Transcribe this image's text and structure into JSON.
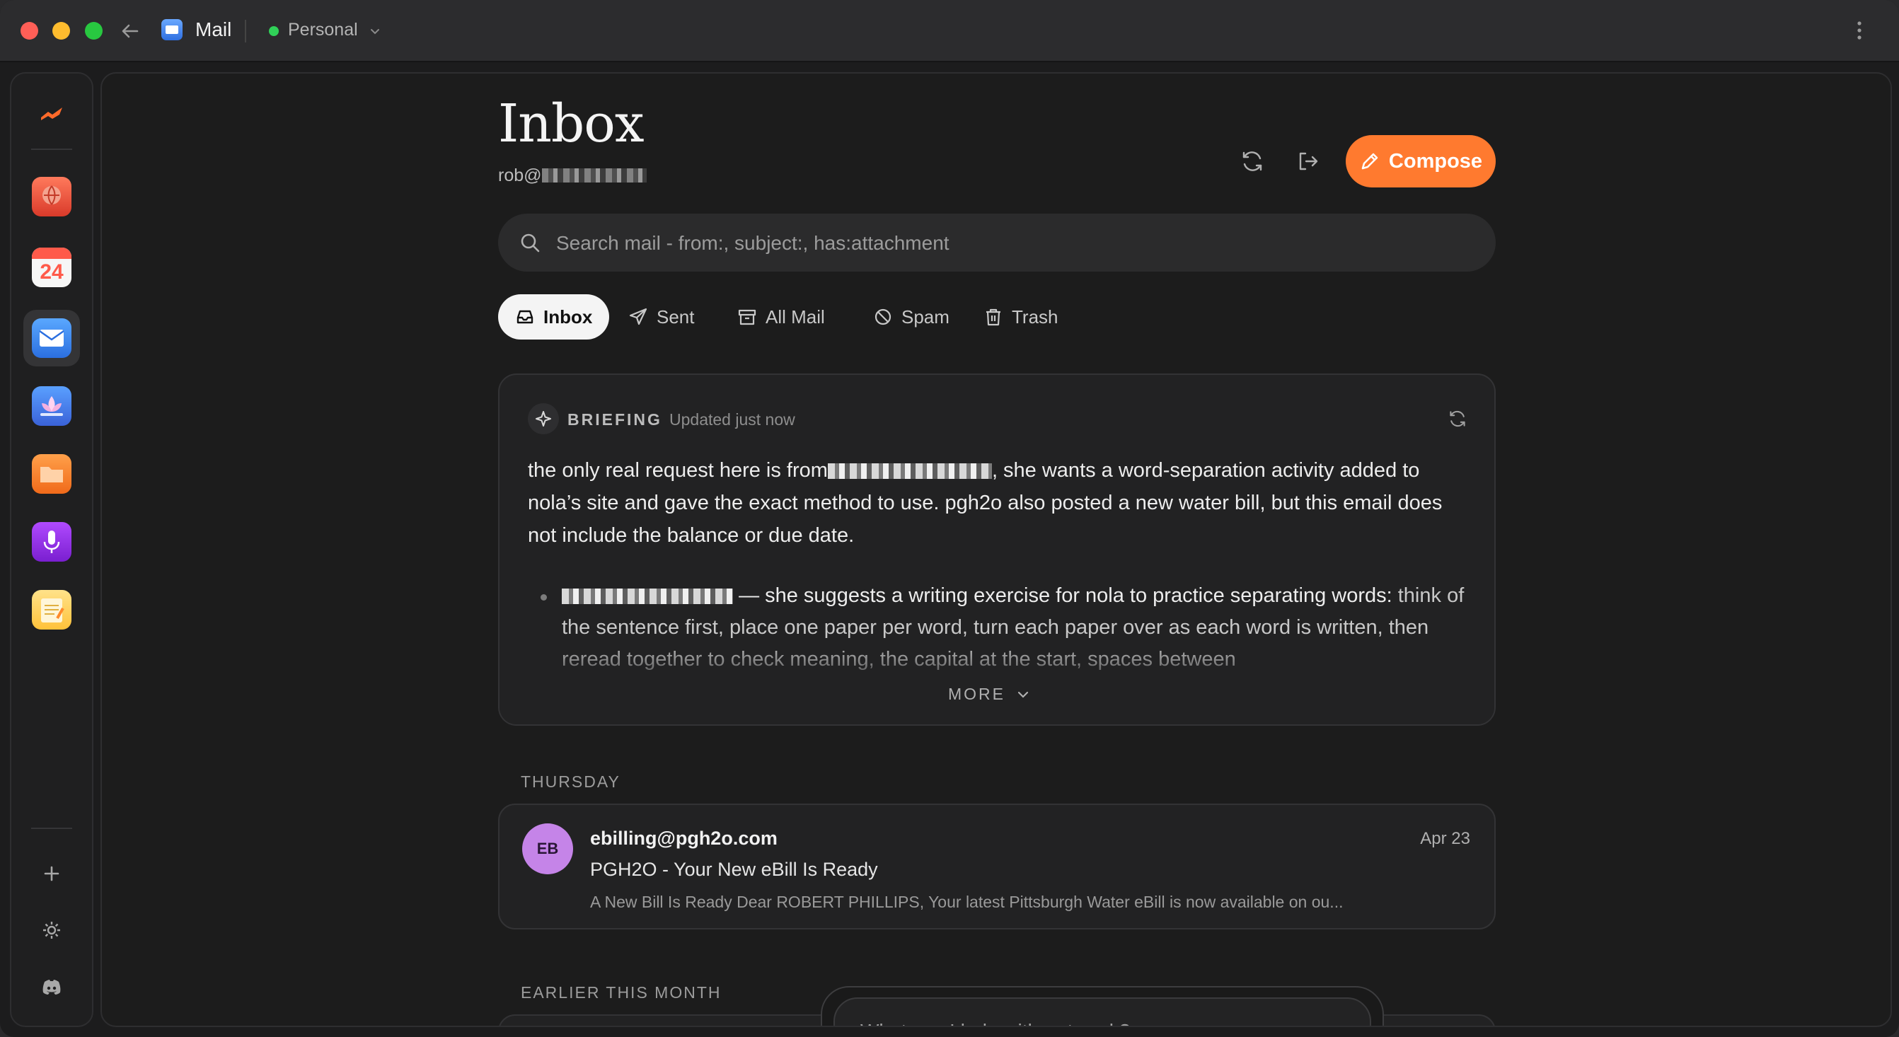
{
  "titlebar": {
    "app_title": "Mail",
    "profile": "Personal"
  },
  "dock": {
    "items": [
      {
        "name": "atlas-app",
        "icon": "globe-book-icon"
      },
      {
        "name": "calendar-app",
        "icon": "calendar-icon",
        "day": "24"
      },
      {
        "name": "mail-app",
        "icon": "mail-icon",
        "active": true
      },
      {
        "name": "lotus-app",
        "icon": "lotus-icon"
      },
      {
        "name": "files-app",
        "icon": "folder-icon"
      },
      {
        "name": "voice-app",
        "icon": "microphone-icon"
      },
      {
        "name": "notes-app",
        "icon": "notepad-icon"
      }
    ],
    "bottom": [
      "plus-icon",
      "gear-icon",
      "discord-icon"
    ]
  },
  "header": {
    "title": "Inbox",
    "account_prefix": "rob@",
    "compose_label": "Compose"
  },
  "search": {
    "placeholder": "Search mail - from:, subject:, has:attachment"
  },
  "tabs": [
    {
      "label": "Inbox",
      "active": true
    },
    {
      "label": "Sent"
    },
    {
      "label": "All Mail"
    },
    {
      "label": "Spam"
    },
    {
      "label": "Trash"
    }
  ],
  "briefing": {
    "label": "BRIEFING",
    "updated": "Updated just now",
    "summary_before": "the only real request here is from",
    "summary_after": ", she wants a word-separation activity added to nola’s site and gave the exact method to use. pgh2o also posted a new water bill, but this email does not include the balance or due date.",
    "bullet_text": "— she suggests a writing exercise for nola to practice separating words:",
    "bullet_cont": "think of the sentence first, place one paper per word, turn each paper over as each word is written, then reread together to check meaning, the capital at the start, spaces between",
    "more_label": "MORE"
  },
  "sections": {
    "thursday": "THURSDAY",
    "earlier": "EARLIER THIS MONTH"
  },
  "emails": [
    {
      "initials": "EB",
      "from": "ebilling@pgh2o.com",
      "date": "Apr 23",
      "subject": "PGH2O - Your New eBill Is Ready",
      "snippet": "A New Bill Is Ready Dear ROBERT PHILLIPS, Your latest Pittsburgh Water eBill is now available on ou..."
    }
  ],
  "assistant": {
    "placeholder": "What can I help with or tweak?"
  },
  "colors": {
    "accent": "#ff7a2f",
    "avatar": "#c584e8",
    "status_dot": "#30d158"
  }
}
